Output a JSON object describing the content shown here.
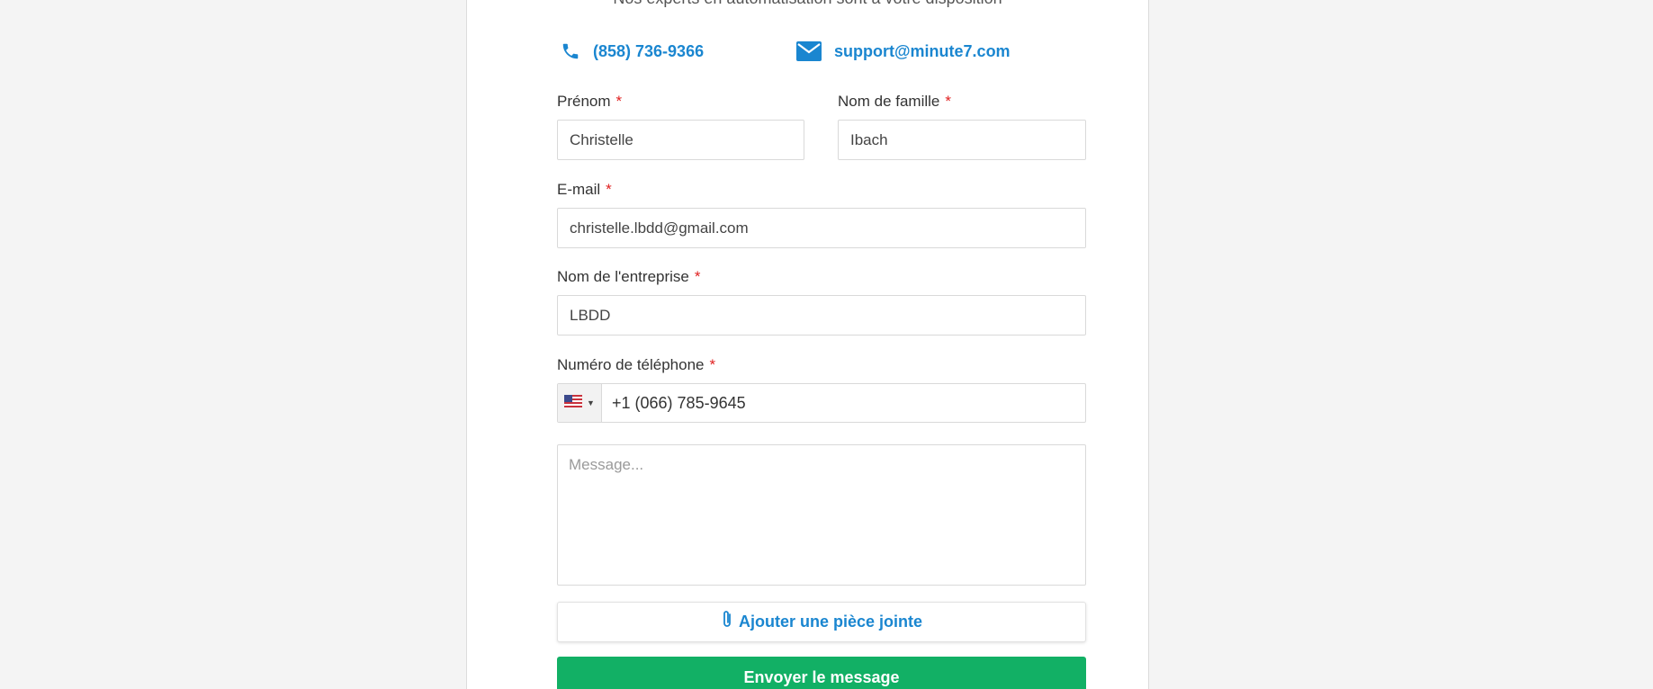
{
  "header": {
    "partial_text": "Nos experts en automatisation sont à votre disposition"
  },
  "contact": {
    "phone": "(858) 736-9366",
    "email": "support@minute7.com"
  },
  "form": {
    "first_name": {
      "label": "Prénom",
      "required_mark": "*",
      "value": "Christelle"
    },
    "last_name": {
      "label": "Nom de famille",
      "required_mark": "*",
      "value": "Ibach"
    },
    "email": {
      "label": "E-mail",
      "required_mark": "*",
      "value": "christelle.lbdd@gmail.com"
    },
    "company": {
      "label": "Nom de l'entreprise",
      "required_mark": "*",
      "value": "LBDD"
    },
    "phone": {
      "label": "Numéro de téléphone",
      "required_mark": "*",
      "country_flag": "us-flag-icon",
      "value": "+1 (066) 785-9645"
    },
    "message": {
      "placeholder": "Message...",
      "value": ""
    },
    "attach_label": "Ajouter une pièce jointe",
    "submit_label": "Envoyer le message"
  },
  "colors": {
    "accent": "#1a86d0",
    "required": "#e02020",
    "submit": "#12b065",
    "background": "#f4f4f4"
  }
}
